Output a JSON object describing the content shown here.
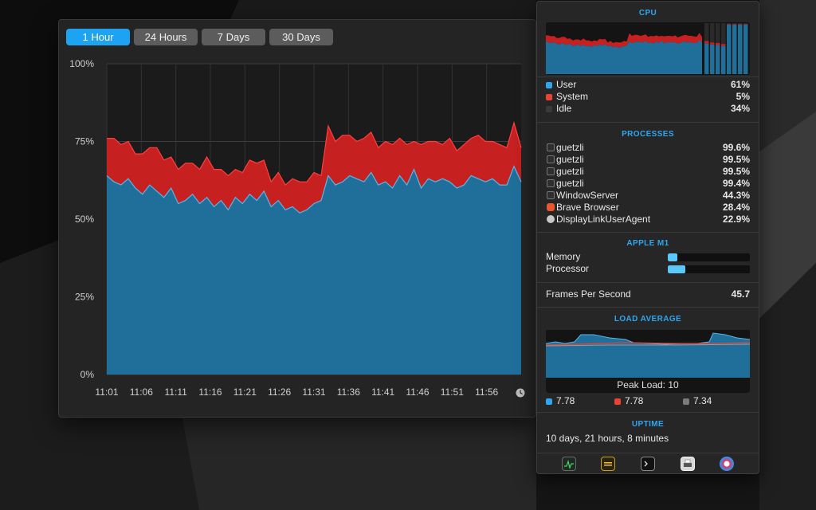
{
  "history": {
    "tabs": [
      {
        "label": "1 Hour",
        "active": true
      },
      {
        "label": "24 Hours",
        "active": false
      },
      {
        "label": "7 Days",
        "active": false
      },
      {
        "label": "30 Days",
        "active": false
      }
    ]
  },
  "chart_data": {
    "type": "area",
    "title": "",
    "xlabel": "",
    "ylabel": "",
    "ylim": [
      0,
      100
    ],
    "y_ticks": [
      "100%",
      "75%",
      "50%",
      "25%",
      "0%"
    ],
    "x_ticks": [
      "11:01",
      "11:06",
      "11:11",
      "11:16",
      "11:21",
      "11:26",
      "11:31",
      "11:36",
      "11:41",
      "11:46",
      "11:51",
      "11:56"
    ],
    "stacked": true,
    "grid": true,
    "series": [
      {
        "name": "User",
        "color": "#1f6f9a",
        "line_color": "#5ab5e8",
        "values": [
          64,
          62,
          61,
          63,
          60,
          58,
          61,
          59,
          57,
          60,
          55,
          56,
          58,
          55,
          57,
          54,
          56,
          53,
          57,
          55,
          58,
          56,
          59,
          54,
          56,
          53,
          54,
          52,
          53,
          55,
          56,
          64,
          61,
          62,
          64,
          63,
          62,
          65,
          61,
          62,
          60,
          64,
          61,
          66,
          60,
          63,
          62,
          63,
          62,
          60,
          61,
          64,
          63,
          62,
          63,
          61,
          61,
          67,
          62
        ]
      },
      {
        "name": "System",
        "color": "#c62020",
        "line_color": "#ff4040",
        "values": [
          12,
          14,
          13,
          12,
          11,
          13,
          12,
          14,
          12,
          10,
          11,
          12,
          10,
          11,
          13,
          12,
          10,
          11,
          9,
          10,
          11,
          12,
          10,
          8,
          9,
          8,
          9,
          10,
          9,
          10,
          8,
          16,
          14,
          15,
          13,
          12,
          14,
          13,
          12,
          13,
          14,
          12,
          13,
          9,
          14,
          12,
          13,
          11,
          14,
          12,
          13,
          12,
          14,
          13,
          12,
          13,
          12,
          14,
          11
        ]
      }
    ]
  },
  "panel": {
    "cpu": {
      "title": "CPU",
      "user": {
        "label": "User",
        "value": "61%",
        "color": "#2ea6f0"
      },
      "system": {
        "label": "System",
        "value": "5%",
        "color": "#ea4335"
      },
      "idle": {
        "label": "Idle",
        "value": "34%",
        "color": "#3a3a3a"
      },
      "cores": [
        {
          "user": 0.6,
          "system": 0.05
        },
        {
          "user": 0.58,
          "system": 0.04
        },
        {
          "user": 0.57,
          "system": 0.04
        },
        {
          "user": 0.55,
          "system": 0.04
        },
        {
          "user": 0.97,
          "system": 0.01
        },
        {
          "user": 0.97,
          "system": 0.01
        },
        {
          "user": 0.97,
          "system": 0.01
        },
        {
          "user": 0.97,
          "system": 0.01
        }
      ]
    },
    "processes": {
      "title": "PROCESSES",
      "items": [
        {
          "name": "guetzli",
          "value": "99.6%",
          "icon": "terminal-icon"
        },
        {
          "name": "guetzli",
          "value": "99.5%",
          "icon": "terminal-icon"
        },
        {
          "name": "guetzli",
          "value": "99.5%",
          "icon": "terminal-icon"
        },
        {
          "name": "guetzli",
          "value": "99.4%",
          "icon": "terminal-icon"
        },
        {
          "name": "WindowServer",
          "value": "44.3%",
          "icon": "terminal-icon"
        },
        {
          "name": "Brave Browser",
          "value": "28.4%",
          "icon": "brave-icon"
        },
        {
          "name": "DisplayLinkUserAgent",
          "value": "22.9%",
          "icon": "displaylink-icon"
        }
      ]
    },
    "gpu": {
      "title": "APPLE M1",
      "memory_label": "Memory",
      "memory_fraction": 0.12,
      "processor_label": "Processor",
      "processor_fraction": 0.21
    },
    "fps": {
      "label": "Frames Per Second",
      "value": "45.7"
    },
    "load": {
      "title": "LOAD AVERAGE",
      "peak": "Peak Load: 10",
      "values": [
        {
          "value": "7.78",
          "color": "#2ea6f0"
        },
        {
          "value": "7.78",
          "color": "#ea4335"
        },
        {
          "value": "7.34",
          "color": "#7a7a7a"
        }
      ]
    },
    "uptime": {
      "title": "UPTIME",
      "value": "10 days, 21 hours, 8 minutes"
    },
    "bottom_icons": [
      "activity-monitor-icon",
      "istat-icon",
      "terminal-app-icon",
      "printer-icon",
      "system-info-icon"
    ]
  }
}
